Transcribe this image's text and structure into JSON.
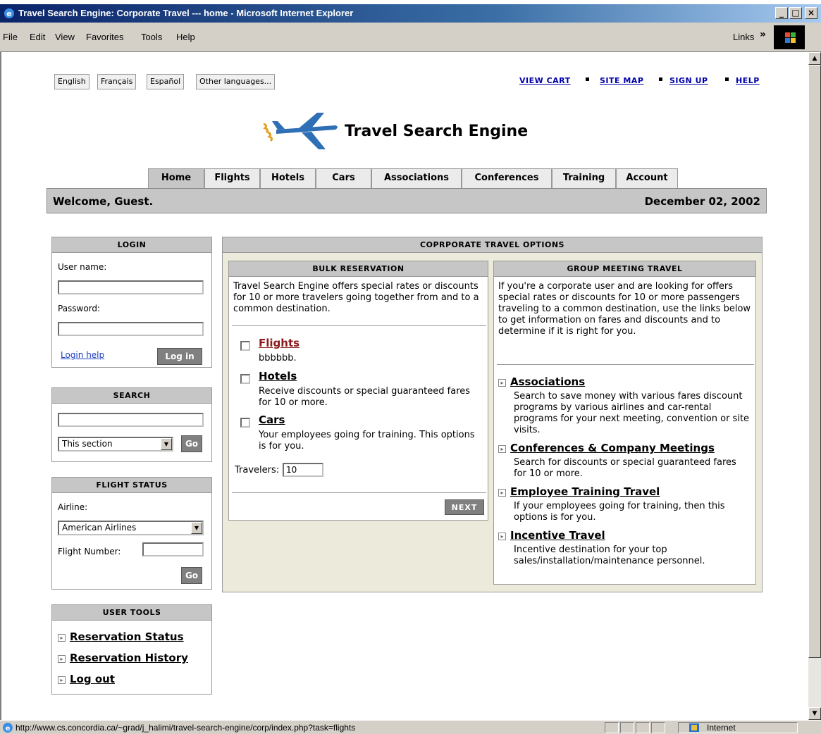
{
  "browser": {
    "title": "Travel Search Engine: Corporate Travel --- home - Microsoft Internet Explorer",
    "menu": [
      "File",
      "Edit",
      "View",
      "Favorites",
      "Tools",
      "Help"
    ],
    "links_label": "Links",
    "status_url": "http://www.cs.concordia.ca/~grad/j_halimi/travel-search-engine/corp/index.php?task=flights",
    "zone": "Internet"
  },
  "languages": [
    "English",
    "Français",
    "Español",
    "Other languages..."
  ],
  "top_links": [
    "VIEW CART",
    "SITE MAP",
    "SIGN UP",
    "HELP"
  ],
  "site_title": "Travel Search Engine",
  "tabs": [
    "Home",
    "Flights",
    "Hotels",
    "Cars",
    "Associations",
    "Conferences",
    "Training",
    "Account"
  ],
  "welcome": {
    "greeting": "Welcome, Guest.",
    "date": "December 02, 2002"
  },
  "login": {
    "title": "LOGIN",
    "username_label": "User name:",
    "password_label": "Password:",
    "help_link": "Login help",
    "button": "Log in"
  },
  "search": {
    "title": "SEARCH",
    "scope": "This section",
    "button": "Go"
  },
  "flight_status": {
    "title": "FLIGHT STATUS",
    "airline_label": "Airline:",
    "airline": "American Airlines",
    "flight_number_label": "Flight Number:",
    "button": "Go"
  },
  "user_tools": {
    "title": "USER TOOLS",
    "links": [
      "Reservation Status",
      "Reservation History",
      "Log out"
    ]
  },
  "corporate": {
    "title": "COPRPORATE TRAVEL OPTIONS",
    "bulk": {
      "title": "BULK RESERVATION",
      "intro": "Travel Search Engine offers special rates or discounts for 10 or more travelers going together from and to a common destination.",
      "options": [
        {
          "label": "Flights",
          "desc": "bbbbbb."
        },
        {
          "label": "Hotels",
          "desc": "Receive discounts or special guaranteed fares for 10 or more."
        },
        {
          "label": "Cars",
          "desc": "Your employees going for training. This options is for you."
        }
      ],
      "travelers_label": "Travelers:",
      "travelers_value": "10",
      "next_button": "NEXT"
    },
    "group": {
      "title": "GROUP MEETING TRAVEL",
      "intro": "If you're a corporate user and are looking for offers special rates or discounts for 10 or more passengers traveling to a common destination, use the links below to get information on fares and discounts and to determine if it is right for you.",
      "items": [
        {
          "label": "Associations",
          "desc": "Search to save money with various fares discount programs by various airlines and car-rental programs for your next meeting, convention or site visits."
        },
        {
          "label": "Conferences & Company Meetings",
          "desc": "Search for discounts or special guaranteed fares for 10 or more."
        },
        {
          "label": "Employee Training Travel",
          "desc": "If your employees going for training, then this options is for you."
        },
        {
          "label": "Incentive Travel",
          "desc": "Incentive destination for your top sales/installation/maintenance personnel."
        }
      ]
    }
  }
}
